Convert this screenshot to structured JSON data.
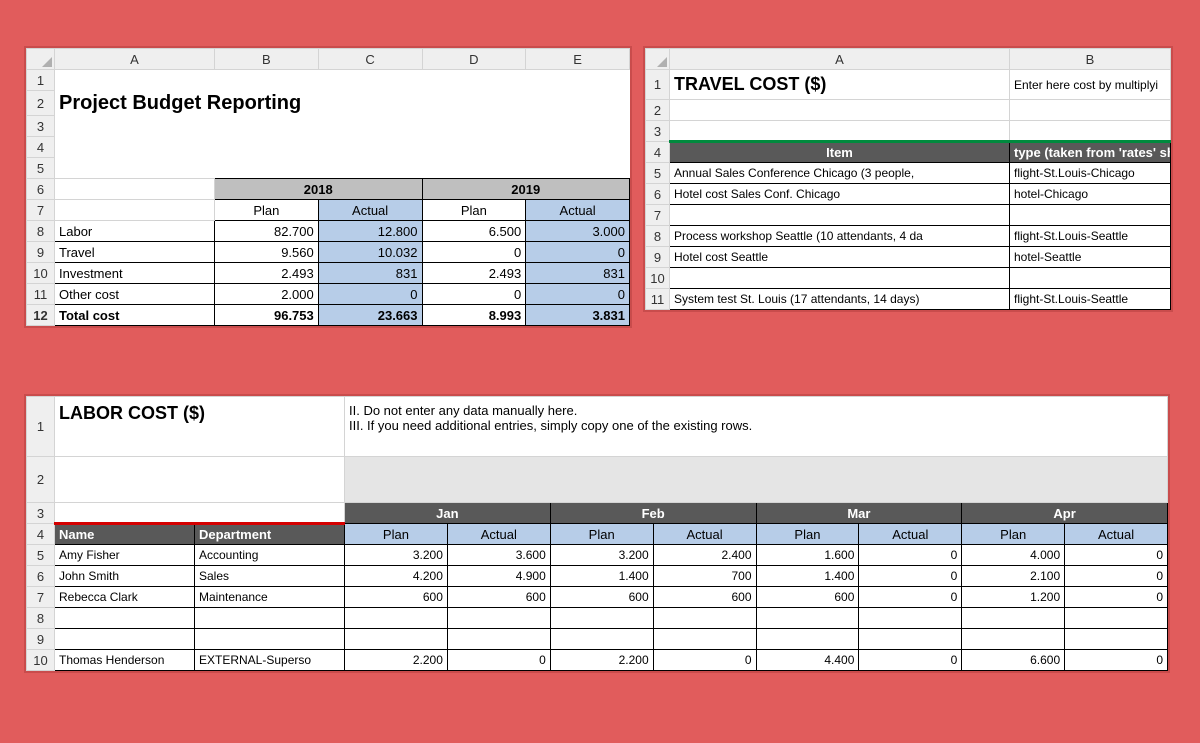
{
  "budget": {
    "cols": [
      "A",
      "B",
      "C",
      "D",
      "E"
    ],
    "title": "Project Budget Reporting",
    "year1": "2018",
    "year2": "2019",
    "plan": "Plan",
    "actual": "Actual",
    "rows": [
      {
        "n": "8",
        "label": "Labor",
        "p1": "82.700",
        "a1": "12.800",
        "p2": "6.500",
        "a2": "3.000"
      },
      {
        "n": "9",
        "label": "Travel",
        "p1": "9.560",
        "a1": "10.032",
        "p2": "0",
        "a2": "0"
      },
      {
        "n": "10",
        "label": "Investment",
        "p1": "2.493",
        "a1": "831",
        "p2": "2.493",
        "a2": "831"
      },
      {
        "n": "11",
        "label": "Other cost",
        "p1": "2.000",
        "a1": "0",
        "p2": "0",
        "a2": "0"
      },
      {
        "n": "12",
        "label": "Total cost",
        "p1": "96.753",
        "a1": "23.663",
        "p2": "8.993",
        "a2": "3.831"
      }
    ]
  },
  "travel": {
    "cols": [
      "A",
      "B"
    ],
    "title": "TRAVEL COST ($)",
    "hint": "Enter here cost by multiplyi",
    "hdr_item": "Item",
    "hdr_type": "type (taken from 'rates' sheet)",
    "rows": [
      {
        "n": "5",
        "item": "Annual Sales Conference Chicago (3 people,",
        "type": "flight-St.Louis-Chicago"
      },
      {
        "n": "6",
        "item": "Hotel cost Sales Conf. Chicago",
        "type": "hotel-Chicago"
      },
      {
        "n": "7",
        "item": "",
        "type": ""
      },
      {
        "n": "8",
        "item": "Process workshop Seattle (10 attendants, 4 da",
        "type": "flight-St.Louis-Seattle"
      },
      {
        "n": "9",
        "item": "Hotel cost Seattle",
        "type": "hotel-Seattle"
      },
      {
        "n": "10",
        "item": "",
        "type": ""
      },
      {
        "n": "11",
        "item": "System test St. Louis (17 attendants, 14 days)",
        "type": "flight-St.Louis-Seattle"
      }
    ]
  },
  "labor": {
    "title": "LABOR COST ($)",
    "note1": "II. Do not enter any data manually here.",
    "note2": "III. If you need additional entries, simply copy one of the existing rows.",
    "months": [
      "Jan",
      "Feb",
      "Mar",
      "Apr"
    ],
    "hdr_name": "Name",
    "hdr_dept": "Department",
    "plan": "Plan",
    "actual": "Actual",
    "rows": [
      {
        "n": "5",
        "name": "Amy Fisher",
        "dept": "Accounting",
        "d": [
          "3.200",
          "3.600",
          "3.200",
          "2.400",
          "1.600",
          "0",
          "4.000",
          "0"
        ]
      },
      {
        "n": "6",
        "name": "John Smith",
        "dept": "Sales",
        "d": [
          "4.200",
          "4.900",
          "1.400",
          "700",
          "1.400",
          "0",
          "2.100",
          "0"
        ]
      },
      {
        "n": "7",
        "name": "Rebecca Clark",
        "dept": "Maintenance",
        "d": [
          "600",
          "600",
          "600",
          "600",
          "600",
          "0",
          "1.200",
          "0"
        ]
      },
      {
        "n": "8",
        "name": "",
        "dept": "",
        "d": [
          "",
          "",
          "",
          "",
          "",
          "",
          "",
          ""
        ]
      },
      {
        "n": "9",
        "name": "",
        "dept": "",
        "d": [
          "",
          "",
          "",
          "",
          "",
          "",
          "",
          ""
        ]
      },
      {
        "n": "10",
        "name": "Thomas Henderson",
        "dept": "EXTERNAL-Superso",
        "d": [
          "2.200",
          "0",
          "2.200",
          "0",
          "4.400",
          "0",
          "6.600",
          "0"
        ]
      }
    ]
  }
}
